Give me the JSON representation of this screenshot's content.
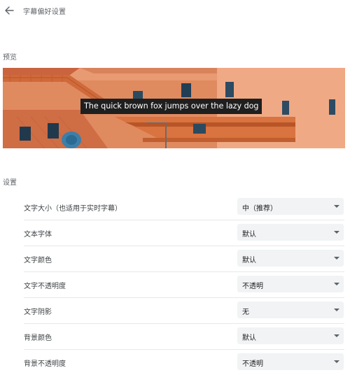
{
  "header": {
    "title": "字幕偏好设置",
    "back_icon": "arrow-back-icon"
  },
  "preview": {
    "label": "预览",
    "caption": "The quick brown fox jumps over the lazy dog"
  },
  "settings": {
    "label": "设置",
    "rows": [
      {
        "label": "文字大小（也适用于实时字幕）",
        "value": "中（推荐）"
      },
      {
        "label": "文本字体",
        "value": "默认"
      },
      {
        "label": "文字颜色",
        "value": "默认"
      },
      {
        "label": "文字不透明度",
        "value": "不透明"
      },
      {
        "label": "文字阴影",
        "value": "无"
      },
      {
        "label": "背景颜色",
        "value": "默认"
      },
      {
        "label": "背景不透明度",
        "value": "不透明"
      }
    ]
  },
  "colors": {
    "caption_bg": "#1f1f1f",
    "select_bg": "#f1f3f4",
    "building_orange": "#e3926a"
  }
}
